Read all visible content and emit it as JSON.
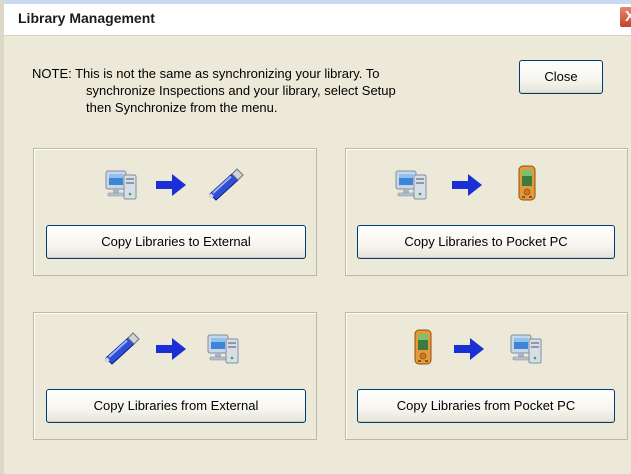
{
  "window": {
    "title": "Library Management",
    "close_glyph": "X"
  },
  "note": {
    "line1": "NOTE: This is not the same as synchronizing your library. To",
    "line2": "synchronize Inspections and your library, select Setup",
    "line3": "then Synchronize from the menu."
  },
  "buttons": {
    "close": "Close",
    "copy_to_external": "Copy Libraries to External",
    "copy_to_pocket_pc": "Copy Libraries to Pocket PC",
    "copy_from_external": "Copy Libraries from External",
    "copy_from_pocket_pc": "Copy Libraries from Pocket PC"
  },
  "icons": {
    "computer": "computer-icon",
    "usb_drive": "usb-drive-icon",
    "pocket_pc": "pocket-pc-icon",
    "arrow": "arrow-right-icon"
  },
  "colors": {
    "window_bg": "#ece9d8",
    "arrow": "#1a2fd6",
    "button_border": "#003c74",
    "titlebar_close": "#c6412b"
  }
}
